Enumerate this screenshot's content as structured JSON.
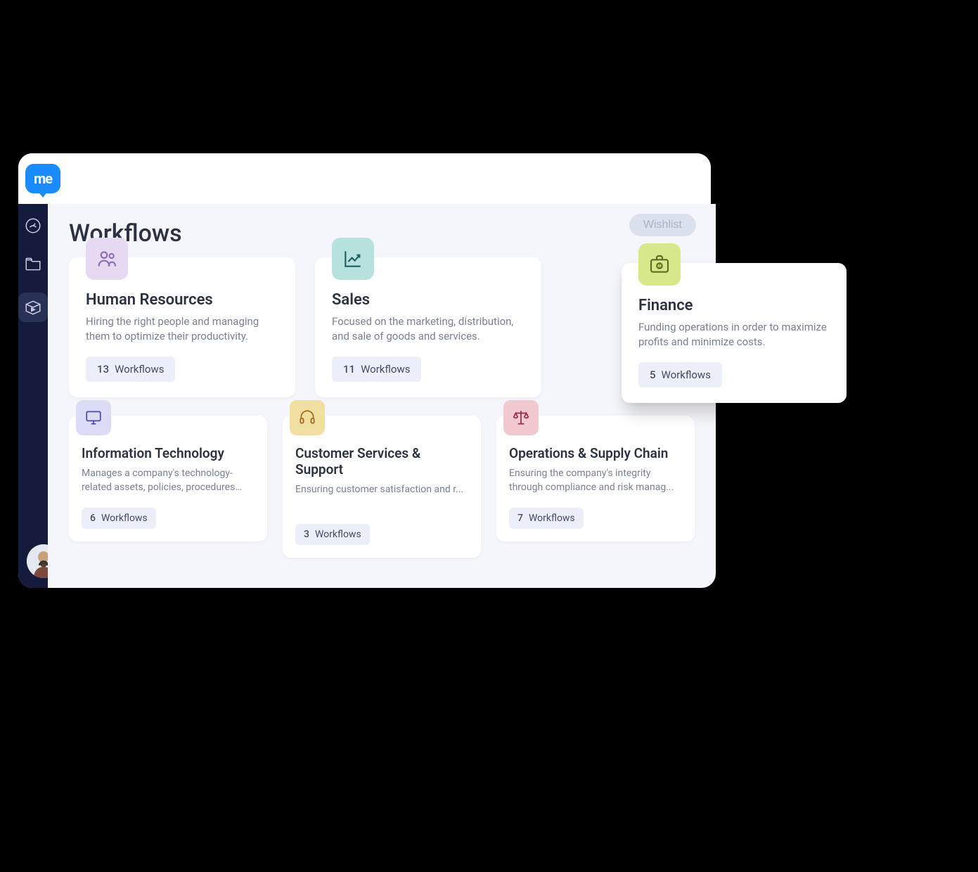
{
  "logo_text": "me",
  "page_title": "Workflows",
  "wishlist_label": "Wishlist",
  "workflows_label": "Workflows",
  "colors": {
    "hr_bg": "#e6d9f2",
    "hr_stroke": "#8c6db5",
    "sales_bg": "#b7e1dc",
    "sales_stroke": "#1f5f61",
    "finance_bg": "#d6e88a",
    "finance_stroke": "#5c6b1f",
    "it_bg": "#dcdcf7",
    "it_stroke": "#4a4aa8",
    "cs_bg": "#f0dfa0",
    "cs_stroke": "#a06a1e",
    "ops_bg": "#f2c9d0",
    "ops_stroke": "#9c2b4a"
  },
  "cards": {
    "hr": {
      "title": "Human Resources",
      "desc": "Hiring the right people and managing them to optimize their productivity.",
      "count": "13"
    },
    "sales": {
      "title": "Sales",
      "desc": "Focused on the marketing, distribution, and sale of goods and services.",
      "count": "11"
    },
    "finance": {
      "title": "Finance",
      "desc": "Funding operations in order to maximize profits and minimize costs.",
      "count": "5"
    },
    "it": {
      "title": "Information Technology",
      "desc": "Manages a company's technology-related assets, policies, procedures an...",
      "count": "6"
    },
    "cs": {
      "title": "Customer Services & Support",
      "desc": "Ensuring customer satisfaction and r...",
      "count": "3"
    },
    "ops": {
      "title": "Operations & Supply Chain",
      "desc": "Ensuring the company's integrity through compliance and risk manag...",
      "count": "7"
    }
  }
}
